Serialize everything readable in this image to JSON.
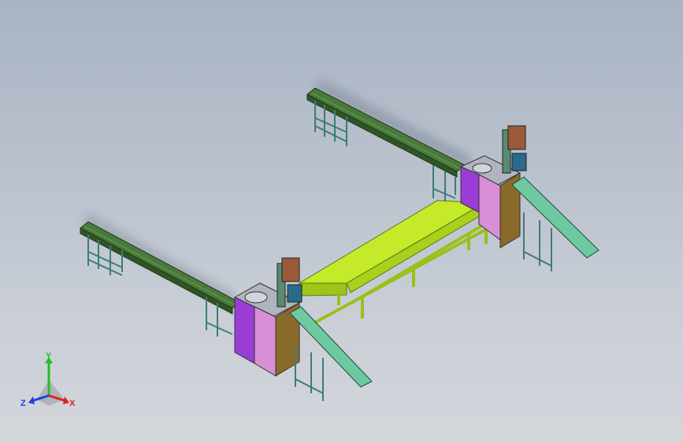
{
  "viewport": {
    "background_top": "#a9b3c3",
    "background_bottom": "#d3d6db"
  },
  "colors": {
    "conveyor_frame": "#4a7a3a",
    "conveyor_belt": "#3f6d33",
    "center_conveyor": "#b8e21c",
    "cabinet_purple": "#9a3dd6",
    "cabinet_pink": "#d98fd6",
    "cabinet_brown": "#8a6a2a",
    "chute": "#6fc9a0",
    "legs": "#4d8f8a",
    "welder_head": "#8a4a2a"
  },
  "scene_objects": [
    "conveyor-back-right",
    "conveyor-front-left",
    "center-conveyor",
    "machine-station-left",
    "machine-station-right",
    "discharge-chute-left",
    "discharge-chute-right"
  ],
  "triad": {
    "x_label": "X",
    "y_label": "Y",
    "z_label": "Z",
    "x_color": "#e02020",
    "y_color": "#20c020",
    "z_color": "#2040e0"
  }
}
